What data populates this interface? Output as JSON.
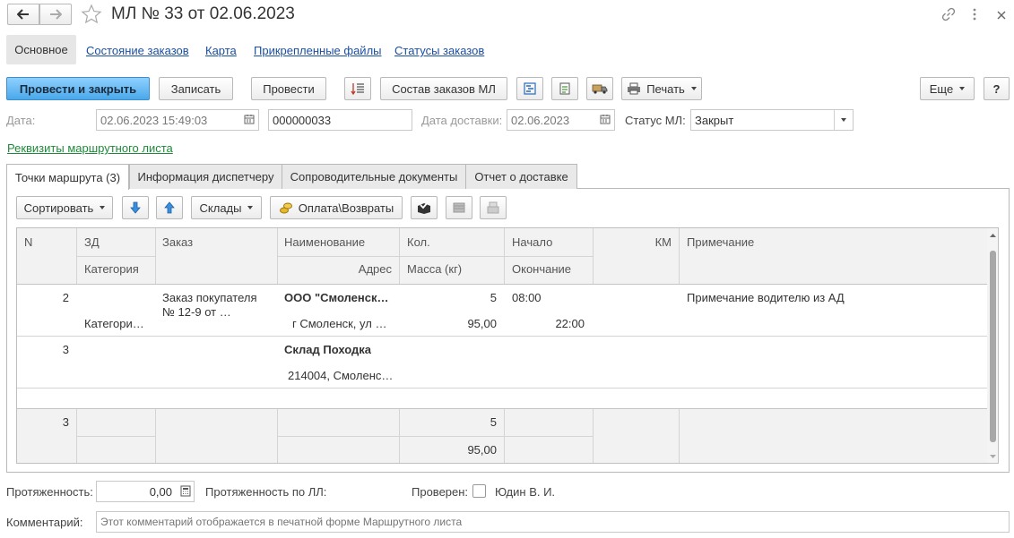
{
  "window": {
    "title": "МЛ № 33 от 02.06.2023"
  },
  "nav_tabs": [
    {
      "label": "Основное"
    },
    {
      "label": "Состояние заказов"
    },
    {
      "label": "Карта"
    },
    {
      "label": "Прикрепленные файлы"
    },
    {
      "label": "Статусы заказов"
    }
  ],
  "toolbar": {
    "post_close": "Провести и закрыть",
    "save": "Записать",
    "post": "Провести",
    "orders": "Состав заказов МЛ",
    "print": "Печать",
    "more": "Еще",
    "help": "?"
  },
  "header": {
    "date_label": "Дата:",
    "date_value": "02.06.2023 15:49:03",
    "number_value": "000000033",
    "delivery_label": "Дата доставки:",
    "delivery_value": "02.06.2023",
    "status_label": "Статус МЛ:",
    "status_value": "Закрыт",
    "requisites_link": "Реквизиты маршрутного листа"
  },
  "doc_tabs": [
    {
      "label": "Точки маршрута (3)"
    },
    {
      "label": "Информация диспетчеру"
    },
    {
      "label": "Сопроводительные документы"
    },
    {
      "label": "Отчет о доставке"
    }
  ],
  "grid_toolbar": {
    "sort": "Сортировать",
    "warehouses": "Склады",
    "payment": "Оплата\\Возвраты"
  },
  "table": {
    "headers": {
      "n": "N",
      "zd": "ЗД",
      "category": "Категория",
      "order": "Заказ",
      "name": "Наименование",
      "address": "Адрес",
      "qty": "Кол.",
      "mass": "Масса (кг)",
      "start": "Начало",
      "end": "Окончание",
      "km": "КМ",
      "note": "Примечание"
    },
    "rows": [
      {
        "n": "2",
        "category": "Категори…",
        "order_line1": "Заказ покупателя",
        "order_line2": "№ 12-9 от …",
        "name": "ООО \"Смоленск…",
        "address": "г Смоленск,  ул …",
        "qty": "5",
        "mass": "95,00",
        "start": "08:00",
        "end": "22:00",
        "note": "Примечание водителю из АД"
      },
      {
        "n": "3",
        "name": "Склад Походка",
        "address": "214004, Смоленс…"
      }
    ],
    "footer": {
      "n": "3",
      "qty": "5",
      "mass": "95,00"
    }
  },
  "bottom": {
    "length_label": "Протяженность:",
    "length_value": "0,00",
    "length_ll_label": "Протяженность по ЛЛ:",
    "checked_label": "Проверен:",
    "checked_by": "Юдин В. И.",
    "comment_label": "Комментарий:",
    "comment_placeholder": "Этот комментарий отображается в печатной форме Маршрутного листа"
  },
  "colors": {
    "primary_button": "#4aa8ea",
    "link": "#1b4fa0",
    "green_link": "#1f8a3a"
  }
}
